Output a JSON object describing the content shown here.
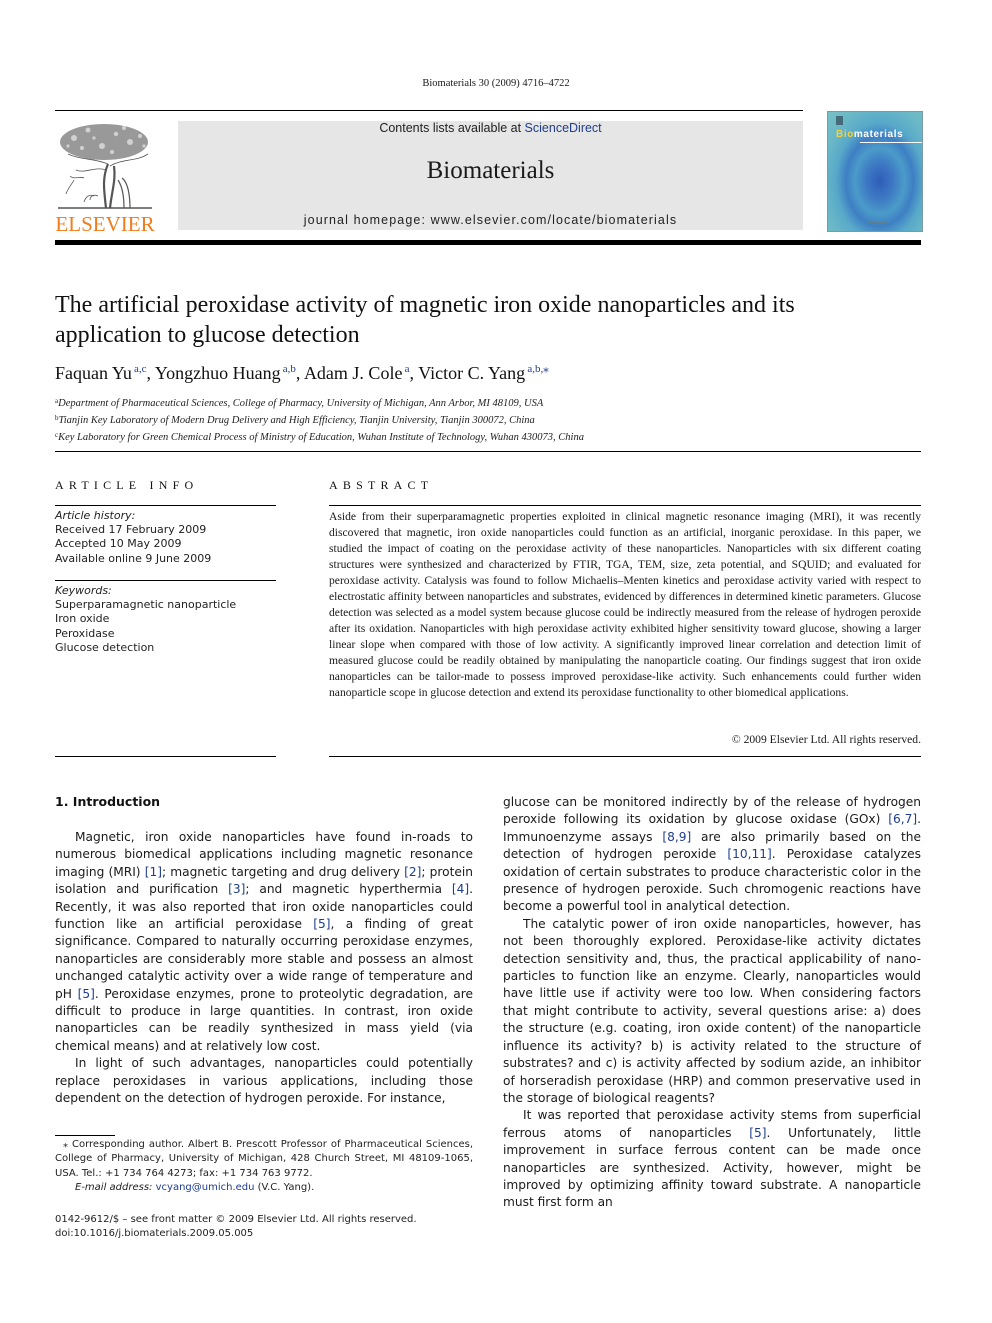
{
  "header": {
    "citation": "Biomaterials 30 (2009) 4716–4722",
    "contents_prefix": "Contents lists available at ",
    "contents_link": "ScienceDirect",
    "journal_title": "Biomaterials",
    "homepage": "journal homepage: www.elsevier.com/locate/biomaterials",
    "publisher_logo_text": "ELSEVIER",
    "cover_title_accent": "Bio",
    "cover_title_rest": "materials"
  },
  "colors": {
    "elsevier_orange": "#f07c1c",
    "link_blue": "#1f3d8f",
    "header_gray": "#e6e6e6"
  },
  "article": {
    "title": "The artificial peroxidase activity of magnetic iron oxide nanoparticles and its application to glucose detection",
    "authors": [
      {
        "name": "Faquan Yu",
        "sup": "a,c",
        "sep": ", "
      },
      {
        "name": "Yongzhuo Huang",
        "sup": "a,b",
        "sep": ", "
      },
      {
        "name": "Adam J. Cole",
        "sup": "a",
        "sep": ", "
      },
      {
        "name": "Victor C. Yang",
        "sup": "a,b,⁎",
        "sep": ""
      }
    ],
    "affiliations": [
      {
        "mark": "a",
        "text": "Department of Pharmaceutical Sciences, College of Pharmacy, University of Michigan, Ann Arbor, MI 48109, USA"
      },
      {
        "mark": "b",
        "text": "Tianjin Key Laboratory of Modern Drug Delivery and High Efficiency, Tianjin University, Tianjin 300072, China"
      },
      {
        "mark": "c",
        "text": "Key Laboratory for Green Chemical Process of Ministry of Education, Wuhan Institute of Technology, Wuhan 430073, China"
      }
    ]
  },
  "article_info": {
    "heading": "ARTICLE INFO",
    "history_label": "Article history:",
    "history": [
      "Received 17 February 2009",
      "Accepted 10 May 2009",
      "Available online 9 June 2009"
    ],
    "keywords_label": "Keywords:",
    "keywords": [
      "Superparamagnetic nanoparticle",
      "Iron oxide",
      "Peroxidase",
      "Glucose detection"
    ]
  },
  "abstract": {
    "heading": "ABSTRACT",
    "text": "Aside from their superparamagnetic properties exploited in clinical magnetic resonance imaging (MRI), it was recently discovered that magnetic, iron oxide nanoparticles could function as an artificial, inorganic peroxidase. In this paper, we studied the impact of coating on the peroxidase activity of these nanoparticles. Nanoparticles with six different coating structures were synthesized and characterized by FTIR, TGA, TEM, size, zeta potential, and SQUID; and evaluated for peroxidase activity. Catalysis was found to follow Michaelis–Menten kinetics and peroxidase activity varied with respect to electrostatic affinity between nanoparticles and substrates, evidenced by differences in determined kinetic parameters. Glucose detection was selected as a model system because glucose could be indirectly measured from the release of hydrogen peroxide after its oxidation. Nanoparticles with high peroxidase activity exhibited higher sensitivity toward glucose, showing a larger linear slope when compared with those of low activity. A significantly improved linear correlation and detection limit of measured glucose could be readily obtained by manipulating the nanoparticle coating. Our findings suggest that iron oxide nanoparticles can be tailor-made to possess improved peroxidase-like activity. Such enhancements could further widen nanoparticle scope in glucose detection and extend its peroxidase functionality to other biomedical applications.",
    "copyright": "© 2009 Elsevier Ltd. All rights reserved."
  },
  "body": {
    "section_heading": "1.  Introduction",
    "left_paragraphs": [
      [
        {
          "t": "Magnetic, iron oxide nanoparticles have found in-roads to numerous biomedical applications including magnetic resonance imaging (MRI) "
        },
        {
          "r": "[1]"
        },
        {
          "t": "; magnetic targeting and drug delivery "
        },
        {
          "r": "[2]"
        },
        {
          "t": "; protein isolation and purification "
        },
        {
          "r": "[3]"
        },
        {
          "t": "; and magnetic hyperthermia "
        },
        {
          "r": "[4]"
        },
        {
          "t": ". Recently, it was also reported that iron oxide nanoparticles could function like an artificial peroxidase "
        },
        {
          "r": "[5]"
        },
        {
          "t": ", a finding of great significance. Compared to naturally occurring peroxidase enzymes, nanoparticles are considerably more stable and possess an almost unchanged catalytic activity over a wide range of temperature and pH "
        },
        {
          "r": "[5]"
        },
        {
          "t": ". Peroxidase enzymes, prone to proteolytic degradation, are difficult to produce in large quantities. In contrast, iron oxide nanoparticles can be readily synthesized in mass yield (via chemical means) and at relatively low cost."
        }
      ],
      [
        {
          "t": "In light of such advantages, nanoparticles could potentially replace peroxidases in various applications, including those dependent on the detection of hydrogen peroxide. For instance,"
        }
      ]
    ],
    "right_paragraphs": [
      [
        {
          "t": "glucose can be monitored indirectly by of the release of hydrogen peroxide following its oxidation by glucose oxidase (GOx) "
        },
        {
          "r": "[6,7]"
        },
        {
          "t": ". Immunoenzyme assays "
        },
        {
          "r": "[8,9]"
        },
        {
          "t": " are also primarily based on the detection of hydrogen peroxide "
        },
        {
          "r": "[10,11]"
        },
        {
          "t": ". Peroxidase catalyzes oxidation of certain substrates to produce characteristic color in the presence of hydrogen peroxide. Such chromogenic reactions have become a powerful tool in analytical detection."
        }
      ],
      [
        {
          "t": "The catalytic power of iron oxide nanoparticles, however, has not been thoroughly explored. Peroxidase-like activity dictates detection sensitivity and, thus, the practical applicability of nano-particles to function like an enzyme. Clearly, nanoparticles would have little use if activity were too low. When considering factors that might contribute to activity, several questions arise: a) does the structure (e.g. coating, iron oxide content) of the nanoparticle influence its activity? b) is activity related to the structure of substrates? and c) is activity affected by sodium azide, an inhibitor of horseradish peroxidase (HRP) and common preservative used in the storage of biological reagents?"
        }
      ],
      [
        {
          "t": "It was reported that peroxidase activity stems from superficial ferrous atoms of nanoparticles "
        },
        {
          "r": "[5]"
        },
        {
          "t": ". Unfortunately, little improvement in surface ferrous content can be made once nanoparticles are synthesized. Activity, however, might be improved by optimizing affinity toward substrate. A nanoparticle must first form an"
        }
      ]
    ]
  },
  "footnote": {
    "star": "⁎",
    "corresponding": "Corresponding author. Albert B. Prescott Professor of Pharmaceutical Sciences, College of Pharmacy, University of Michigan, 428 Church Street, MI 48109-1065, USA. Tel.: +1 734 764 4273; fax: +1 734 763 9772.",
    "email_label": "E-mail address:",
    "email": "vcyang@umich.edu",
    "email_suffix": " (V.C. Yang)."
  },
  "bottom_meta": {
    "issn_line": "0142-9612/$ – see front matter © 2009 Elsevier Ltd. All rights reserved.",
    "doi": "doi:10.1016/j.biomaterials.2009.05.005"
  }
}
